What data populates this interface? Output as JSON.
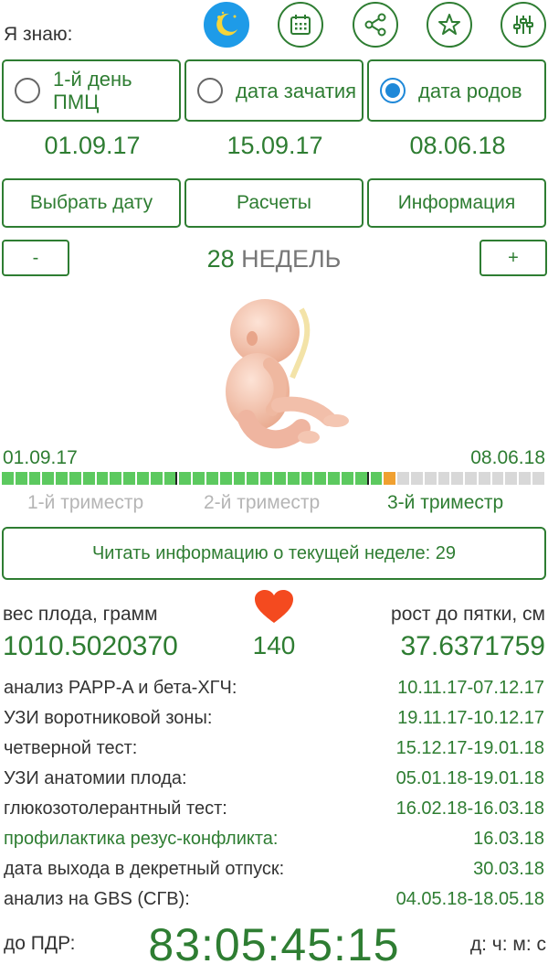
{
  "header": {
    "know_label": "Я знаю:",
    "icons": [
      "night-mode-icon",
      "calendar-icon",
      "share-icon",
      "star-icon",
      "settings-sliders-icon"
    ]
  },
  "options": [
    {
      "label": "1-й день ПМЦ",
      "checked": false,
      "date": "01.09.17"
    },
    {
      "label": "дата зачатия",
      "checked": false,
      "date": "15.09.17"
    },
    {
      "label": "дата родов",
      "checked": true,
      "date": "08.06.18"
    }
  ],
  "actions": {
    "choose_date": "Выбрать дату",
    "calculations": "Расчеты",
    "information": "Информация"
  },
  "week": {
    "minus": "-",
    "plus": "+",
    "number": "28",
    "unit": "НЕДЕЛЬ"
  },
  "timeline": {
    "start": "01.09.17",
    "end": "08.06.18",
    "total_segments": 40,
    "completed_segments": 28,
    "current_segment": 29,
    "trimester_marks": [
      13,
      27
    ],
    "trimesters": [
      {
        "label": "1-й триместр",
        "active": false
      },
      {
        "label": "2-й триместр",
        "active": false
      },
      {
        "label": "3-й триместр",
        "active": true
      }
    ]
  },
  "read_button": "Читать информацию о текущей неделе: 29",
  "stats": {
    "weight_label": "вес плода, грамм",
    "weight_value": "1010.5020370",
    "heart_rate": "140",
    "height_label": "рост до пятки, см",
    "height_value": "37.6371759"
  },
  "schedule": [
    {
      "label": "анализ PAPP-A и бета-ХГЧ:",
      "value": "10.11.17-07.12.17",
      "highlight": false
    },
    {
      "label": "УЗИ воротниковой зоны:",
      "value": "19.11.17-10.12.17",
      "highlight": false
    },
    {
      "label": "четверной тест:",
      "value": "15.12.17-19.01.18",
      "highlight": false
    },
    {
      "label": "УЗИ анатомии плода:",
      "value": "05.01.18-19.01.18",
      "highlight": false
    },
    {
      "label": "глюкозотолерантный тест:",
      "value": "16.02.18-16.03.18",
      "highlight": false
    },
    {
      "label": "профилактика резус-конфликта:",
      "value": "16.03.18",
      "highlight": true
    },
    {
      "label": "дата выхода в декретный отпуск:",
      "value": "30.03.18",
      "highlight": false
    },
    {
      "label": "анализ на GBS (СГВ):",
      "value": "04.05.18-18.05.18",
      "highlight": false
    }
  ],
  "countdown": {
    "label": "до ПДР:",
    "value": "83:05:45:15",
    "units": "д: ч: м: с"
  },
  "colors": {
    "accent_green": "#2e7d32",
    "progress_done": "#5cc95f",
    "progress_current": "#f0a030",
    "radio_blue": "#1e88d8",
    "heart": "#f44a1f"
  }
}
